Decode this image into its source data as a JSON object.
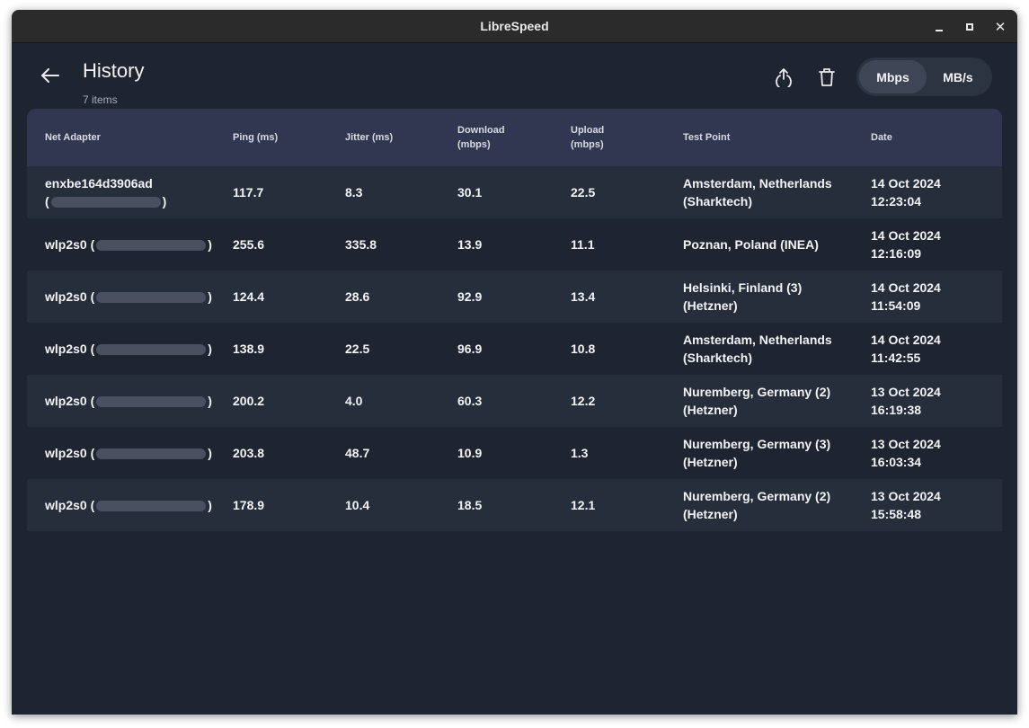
{
  "window": {
    "title": "LibreSpeed"
  },
  "header": {
    "title": "History",
    "subtitle": "7 items"
  },
  "units": {
    "mbps": "Mbps",
    "mbs": "MB/s",
    "selected": "Mbps"
  },
  "table": {
    "columns": [
      "Net Adapter",
      "Ping (ms)",
      "Jitter (ms)",
      "Download\n(mbps)",
      "Upload\n(mbps)",
      "Test Point",
      "Date"
    ],
    "rows": [
      {
        "adapter": "enxbe164d3906ad",
        "ping": "117.7",
        "jitter": "8.3",
        "download": "30.1",
        "upload": "22.5",
        "test_point": "Amsterdam, Netherlands (Sharktech)",
        "date": "14 Oct 2024",
        "time": "12:23:04"
      },
      {
        "adapter": "wlp2s0",
        "ping": "255.6",
        "jitter": "335.8",
        "download": "13.9",
        "upload": "11.1",
        "test_point": "Poznan, Poland (INEA)",
        "date": "14 Oct 2024",
        "time": "12:16:09"
      },
      {
        "adapter": "wlp2s0",
        "ping": "124.4",
        "jitter": "28.6",
        "download": "92.9",
        "upload": "13.4",
        "test_point": "Helsinki, Finland (3) (Hetzner)",
        "date": "14 Oct 2024",
        "time": "11:54:09"
      },
      {
        "adapter": "wlp2s0",
        "ping": "138.9",
        "jitter": "22.5",
        "download": "96.9",
        "upload": "10.8",
        "test_point": "Amsterdam, Netherlands (Sharktech)",
        "date": "14 Oct 2024",
        "time": "11:42:55"
      },
      {
        "adapter": "wlp2s0",
        "ping": "200.2",
        "jitter": "4.0",
        "download": "60.3",
        "upload": "12.2",
        "test_point": "Nuremberg, Germany (2) (Hetzner)",
        "date": "13 Oct 2024",
        "time": "16:19:38"
      },
      {
        "adapter": "wlp2s0",
        "ping": "203.8",
        "jitter": "48.7",
        "download": "10.9",
        "upload": "1.3",
        "test_point": "Nuremberg, Germany (3) (Hetzner)",
        "date": "13 Oct 2024",
        "time": "16:03:34"
      },
      {
        "adapter": "wlp2s0",
        "ping": "178.9",
        "jitter": "10.4",
        "download": "18.5",
        "upload": "12.1",
        "test_point": "Nuremberg, Germany (2) (Hetzner)",
        "date": "13 Oct 2024",
        "time": "15:58:48"
      }
    ]
  },
  "colors": {
    "background": "#1f2530",
    "header_row": "#313750",
    "row_alt": "#272e3b",
    "text": "#f1f3f6"
  }
}
